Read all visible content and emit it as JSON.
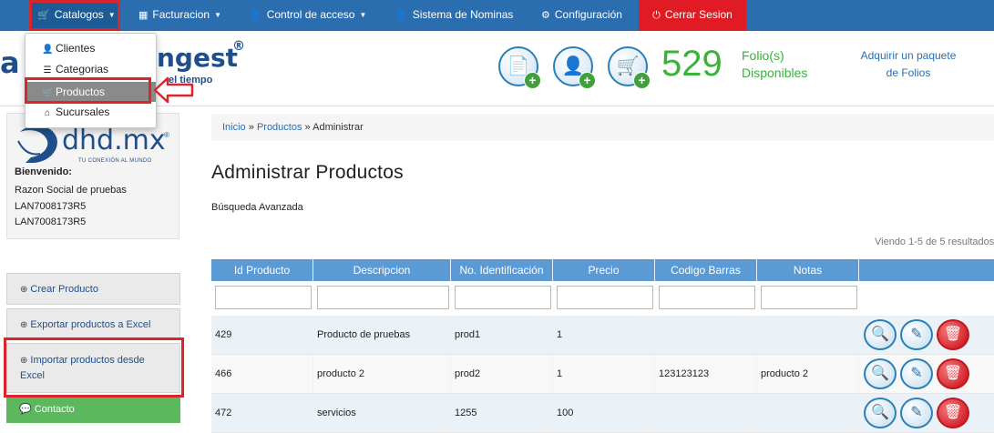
{
  "navbar": {
    "items": [
      {
        "label": "Catalogos",
        "icon": "cart-icon",
        "has_caret": true
      },
      {
        "label": "Facturacion",
        "icon": "barcode-icon",
        "has_caret": true
      },
      {
        "label": "Control de acceso",
        "icon": "user-icon",
        "has_caret": true
      },
      {
        "label": "Sistema de Nominas",
        "icon": "user-icon",
        "has_caret": false
      },
      {
        "label": "Configuración",
        "icon": "gear-icon",
        "has_caret": false
      },
      {
        "label": "Cerrar Sesion",
        "icon": "power-icon",
        "has_caret": false
      }
    ],
    "colors": {
      "bar": "#2a6eb0",
      "logout": "#e01b23",
      "highlight": "#d9252b"
    }
  },
  "dropdown": {
    "items": [
      {
        "label": "Clientes",
        "icon": "user-icon"
      },
      {
        "label": "Categorias",
        "icon": "list-icon"
      },
      {
        "label": "Productos",
        "icon": "cart-icon",
        "active": true
      },
      {
        "label": "Sucursales",
        "icon": "home-icon"
      }
    ]
  },
  "header": {
    "logo_left": "a",
    "logo_right": "ngest",
    "logo_reg": "®",
    "logo_tagline": "el tiempo",
    "folio_count": "529",
    "folio_label_1": "Folio(s)",
    "folio_label_2": "Disponibles",
    "buy_link_1": "Adquirir un paquete",
    "buy_link_2": "de Folios"
  },
  "left": {
    "logo_text": "dhd.mx",
    "logo_reg": "®",
    "logo_tagline": "TU CONEXIÓN AL MUNDO",
    "welcome": "Bienvenido:",
    "company": "Razon Social de pruebas",
    "rfc_1": "LAN7008173R5",
    "rfc_2": "LAN7008173R5",
    "menu": {
      "create": "Crear Producto",
      "export": "Exportar productos a Excel",
      "import_1": "Importar productos desde",
      "import_2": "Excel",
      "contact": "Contacto"
    }
  },
  "breadcrumb": {
    "home": "Inicio",
    "sep": "»",
    "section": "Productos",
    "current": "Administrar"
  },
  "main": {
    "title": "Administrar Productos",
    "advanced_search": "Búsqueda Avanzada",
    "summary": "Viendo 1-5 de 5 resultados"
  },
  "table": {
    "headers": [
      "Id Producto",
      "Descripcion",
      "No. Identificación",
      "Precio",
      "Codigo Barras",
      "Notas"
    ],
    "rows": [
      {
        "id": "429",
        "descripcion": "Producto de pruebas",
        "identificacion": "prod1",
        "precio": "1",
        "codigo": "",
        "notas": ""
      },
      {
        "id": "466",
        "descripcion": "producto 2",
        "identificacion": "prod2",
        "precio": "1",
        "codigo": "123123123",
        "notas": "producto 2"
      },
      {
        "id": "472",
        "descripcion": "servicios",
        "identificacion": "1255",
        "precio": "100",
        "codigo": "",
        "notas": ""
      }
    ],
    "header_color": "#5b9bd5"
  }
}
